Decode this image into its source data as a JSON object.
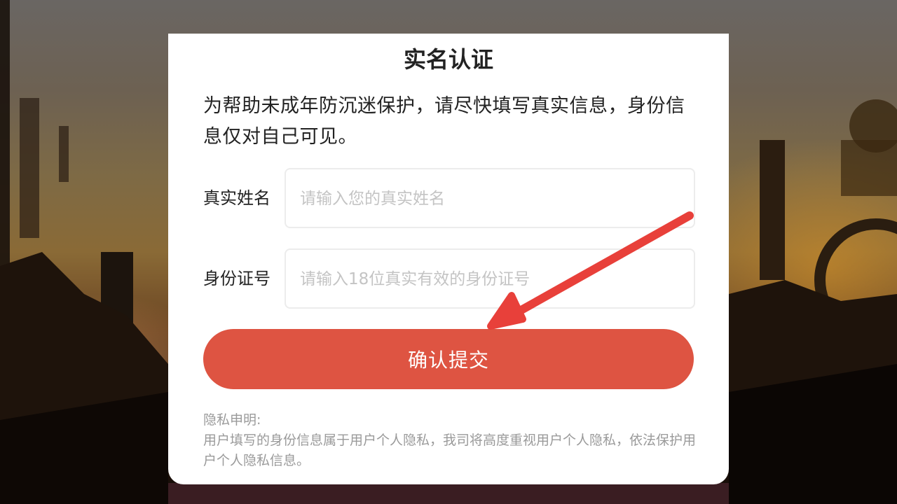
{
  "dialog": {
    "title": "实名认证",
    "intro": "为帮助未成年防沉迷保护，请尽快填写真实信息，身份信息仅对自己可见。"
  },
  "form": {
    "name_label": "真实姓名",
    "name_placeholder": "请输入您的真实姓名",
    "id_label": "身份证号",
    "id_placeholder": "请输入18位真实有效的身份证号",
    "submit_label": "确认提交"
  },
  "privacy": {
    "heading": "隐私申明:",
    "body": "用户填写的身份信息属于用户个人隐私，我司将高度重视用户个人隐私，依法保护用户个人隐私信息。"
  },
  "colors": {
    "accent": "#de5442",
    "arrow": "#e8403a"
  },
  "icons": [
    "annotation-arrow-icon"
  ]
}
